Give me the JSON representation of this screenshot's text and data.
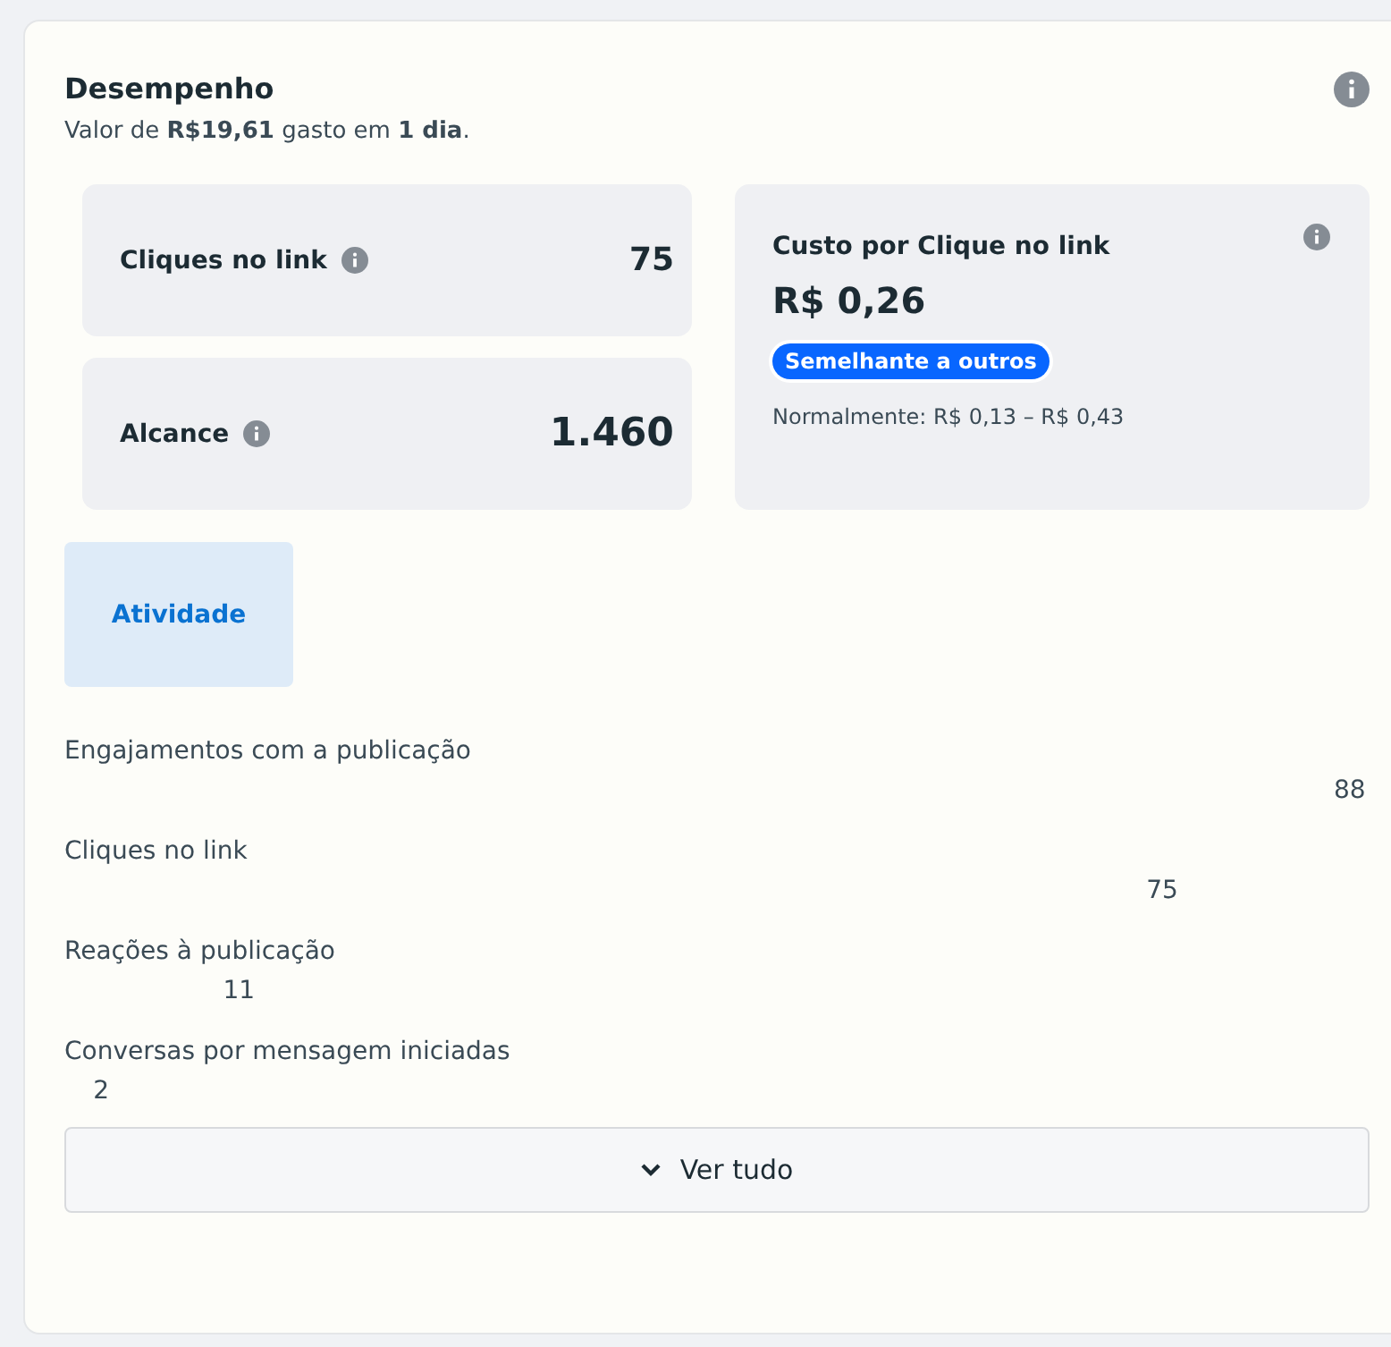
{
  "header": {
    "title": "Desempenho",
    "subtitle": "Valor de **R$19,61** gasto em **1 dia**."
  },
  "metrics": [
    {
      "label": "Cliques no link",
      "value": "75"
    },
    {
      "label": "Alcance",
      "value": "1.460"
    }
  ],
  "cost": {
    "title": "Custo por Clique no link",
    "value": "R$ 0,26",
    "badge": "Semelhante a outros",
    "range": "Normalmente: R$ 0,13 – R$ 0,43"
  },
  "tabs": [
    {
      "label": "Atividade",
      "selected": true
    }
  ],
  "activity": [
    {
      "label": "Engajamentos com a publicação",
      "value": "88"
    },
    {
      "label": "Cliques no link",
      "value": "75"
    },
    {
      "label": "Reações à publicação",
      "value": "11"
    },
    {
      "label": "Conversas por mensagem iniciadas",
      "value": "2"
    }
  ],
  "see_all_button": "Ver tudo"
}
